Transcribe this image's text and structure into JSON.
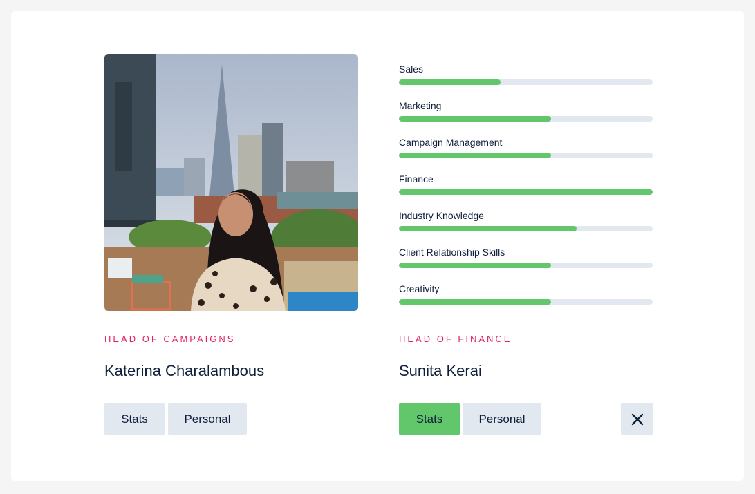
{
  "left_profile": {
    "role": "HEAD OF CAMPAIGNS",
    "name": "Katerina Charalambous",
    "tabs": [
      "Stats",
      "Personal"
    ],
    "active_tab": "none"
  },
  "right_profile": {
    "role": "HEAD OF FINANCE",
    "name": "Sunita Kerai",
    "tabs": [
      "Stats",
      "Personal"
    ],
    "active_tab": "Stats",
    "close_icon": "close-icon"
  },
  "skills": [
    {
      "label": "Sales",
      "level": 0.4
    },
    {
      "label": "Marketing",
      "level": 0.6
    },
    {
      "label": "Campaign Management",
      "level": 0.6
    },
    {
      "label": "Finance",
      "level": 1.0
    },
    {
      "label": "Industry Knowledge",
      "level": 0.7
    },
    {
      "label": "Client Relationship Skills",
      "level": 0.6
    },
    {
      "label": "Creativity",
      "level": 0.6
    }
  ],
  "colors": {
    "accent": "#62c66b",
    "role_text": "#e0245e",
    "track": "#e2e8f0",
    "text": "#0f1f3a"
  }
}
